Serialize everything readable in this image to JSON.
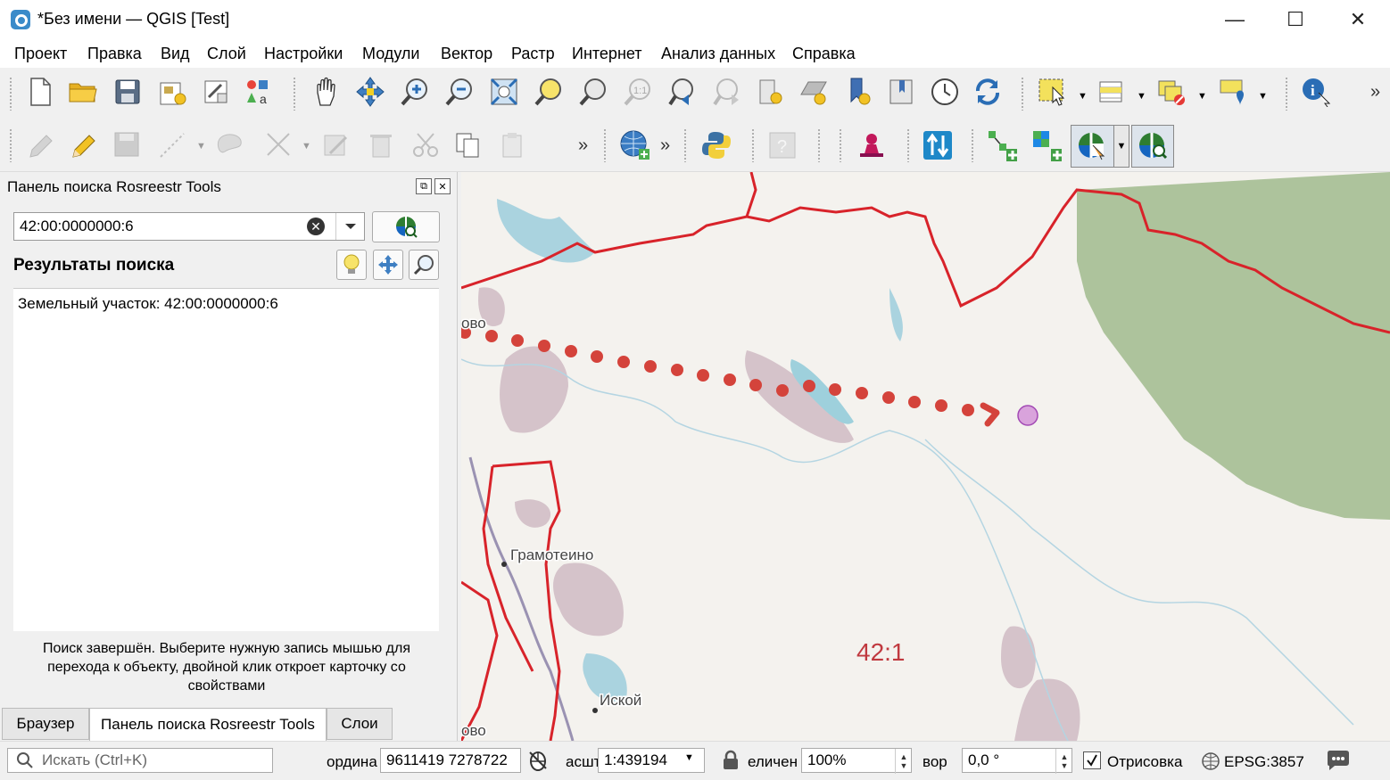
{
  "window": {
    "title": "*Без имени — QGIS [Test]",
    "minimize": "—",
    "maximize": "☐",
    "close": "✕"
  },
  "menu": [
    "Проект",
    "Правка",
    "Вид",
    "Слой",
    "Настройки",
    "Модули",
    "Вектор",
    "Растр",
    "Интернет",
    "Анализ данных",
    "Справка"
  ],
  "toolbar1_icons": [
    "new-project-icon",
    "open-project-icon",
    "save-project-icon",
    "new-print-layout-icon",
    "layout-manager-icon",
    "style-manager-icon",
    "pan-icon",
    "pan-to-selection-icon",
    "zoom-in-icon",
    "zoom-out-icon",
    "zoom-full-icon",
    "zoom-to-selection-icon",
    "zoom-to-layer-icon",
    "zoom-native-icon",
    "zoom-last-icon",
    "zoom-next-icon",
    "new-bookmark-icon",
    "show-bookmarks-icon",
    "new-spatial-bookmark-icon",
    "map-tips-icon",
    "temporal-controller-icon",
    "refresh-icon",
    "select-features-icon",
    "open-attribute-table-icon",
    "deselect-icon",
    "add-annotation-icon",
    "identify-icon"
  ],
  "toolbar2_icons": [
    "current-edits-icon",
    "toggle-editing-icon",
    "save-edits-icon",
    "digitize-icon",
    "add-feature-icon",
    "vertex-tool-icon",
    "modify-attributes-icon",
    "delete-selected-icon",
    "cut-features-icon",
    "copy-features-icon",
    "paste-features-icon",
    "georeferencer-icon",
    "python-console-icon",
    "help-icon",
    "geocoder-icon",
    "sort-icon",
    "add-point-icon",
    "add-layer-icon",
    "rosreestr-select-icon",
    "rosreestr-search-icon"
  ],
  "panel": {
    "title": "Панель поиска Rosreestr Tools",
    "search_value": "42:00:0000000:6",
    "results_title": "Результаты поиска",
    "result_item": "Земельный участок: 42:00:0000000:6",
    "status_message": "Поиск завершён. Выберите нужную запись мышью для перехода к объекту, двойной клик откроет карточку со свойствами",
    "tabs": [
      "Браузер",
      "Панель поиска Rosreestr Tools",
      "Слои"
    ],
    "active_tab": 1
  },
  "map": {
    "labels": {
      "town1": "Грамотеино",
      "town2": "Иской",
      "partial1": "ово",
      "partial2": "ово",
      "region_code": "42:1"
    },
    "colors": {
      "boundary": "#d8232a",
      "forest": "#adc39c",
      "water": "#aad3df",
      "urban": "#d5c3ca",
      "dots": "#d4433b",
      "marker": "#d9a3dc"
    }
  },
  "statusbar": {
    "search_placeholder": "Искать (Ctrl+K)",
    "coord_label": "ордина",
    "coord_value": "9611419  7278722",
    "scale_label": "асшт",
    "scale_value": "1:439194",
    "magnifier_label": "еличен",
    "magnifier_value": "100%",
    "rotation_label": "вор",
    "rotation_value": "0,0 °",
    "render_label": "Отрисовка",
    "render_checked": true,
    "crs": "EPSG:3857"
  }
}
